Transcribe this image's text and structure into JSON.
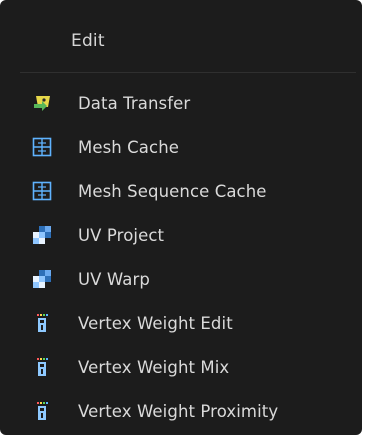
{
  "menu": {
    "title": "Edit",
    "items": [
      {
        "label": "Data Transfer",
        "icon": "data-transfer-icon"
      },
      {
        "label": "Mesh Cache",
        "icon": "mesh-cache-icon"
      },
      {
        "label": "Mesh Sequence Cache",
        "icon": "mesh-sequence-cache-icon"
      },
      {
        "label": "UV Project",
        "icon": "uv-project-icon"
      },
      {
        "label": "UV Warp",
        "icon": "uv-warp-icon"
      },
      {
        "label": "Vertex Weight Edit",
        "icon": "vertex-weight-edit-icon"
      },
      {
        "label": "Vertex Weight Mix",
        "icon": "vertex-weight-mix-icon"
      },
      {
        "label": "Vertex Weight Proximity",
        "icon": "vertex-weight-proximity-icon"
      }
    ]
  },
  "colors": {
    "background": "#1c1c1c",
    "text": "#dadada",
    "mesh_icon_blue": "#5fb3ff",
    "data_transfer_yellow": "#e7d84a",
    "data_transfer_green": "#58b85a"
  }
}
